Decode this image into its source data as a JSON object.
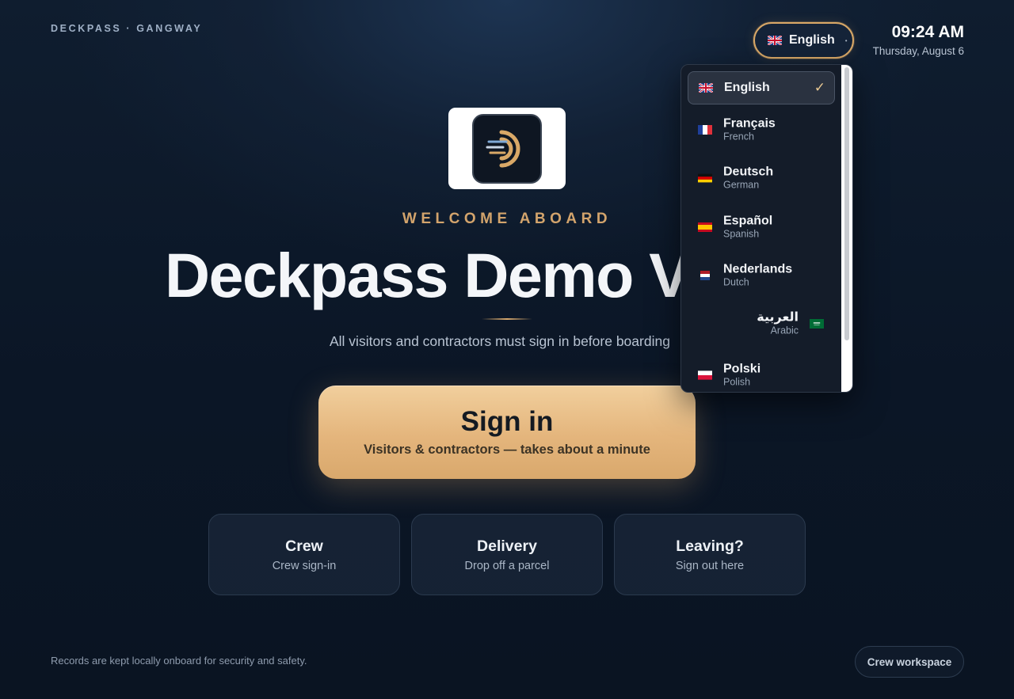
{
  "brand": "DECKPASS · GANGWAY",
  "language_button": {
    "label": "English",
    "caret": "•"
  },
  "clock": {
    "time": "09:24 AM",
    "date": "Thursday, August 6"
  },
  "hero": {
    "eyebrow": "WELCOME ABOARD",
    "title": "Deckpass Demo V",
    "subtitle": "All visitors and contractors must sign in before boarding"
  },
  "signin": {
    "label": "Sign in",
    "sublabel": "Visitors & contractors — takes about a minute"
  },
  "tiles": [
    {
      "title": "Crew",
      "subtitle": "Crew sign-in"
    },
    {
      "title": "Delivery",
      "subtitle": "Drop off a parcel"
    },
    {
      "title": "Leaving?",
      "subtitle": "Sign out here"
    }
  ],
  "footnote": "Records are kept locally onboard for security and safety.",
  "crew_workspace": "Crew workspace",
  "languages": [
    {
      "native": "English",
      "english": "",
      "flag": "uk-flag-icon",
      "selected": true,
      "check": "✓"
    },
    {
      "native": "Français",
      "english": "French",
      "flag": "france-flag-icon"
    },
    {
      "native": "Deutsch",
      "english": "German",
      "flag": "germany-flag-icon"
    },
    {
      "native": "Español",
      "english": "Spanish",
      "flag": "spain-flag-icon"
    },
    {
      "native": "Nederlands",
      "english": "Dutch",
      "flag": "netherlands-flag-icon"
    },
    {
      "native": "العربية",
      "english": "Arabic",
      "flag": "saudi-flag-icon",
      "rtl": true
    },
    {
      "native": "Polski",
      "english": "Polish",
      "flag": "poland-flag-icon"
    }
  ],
  "colors": {
    "accent": "#d9a867",
    "background": "#0c1828",
    "tile": "#1a283a"
  }
}
